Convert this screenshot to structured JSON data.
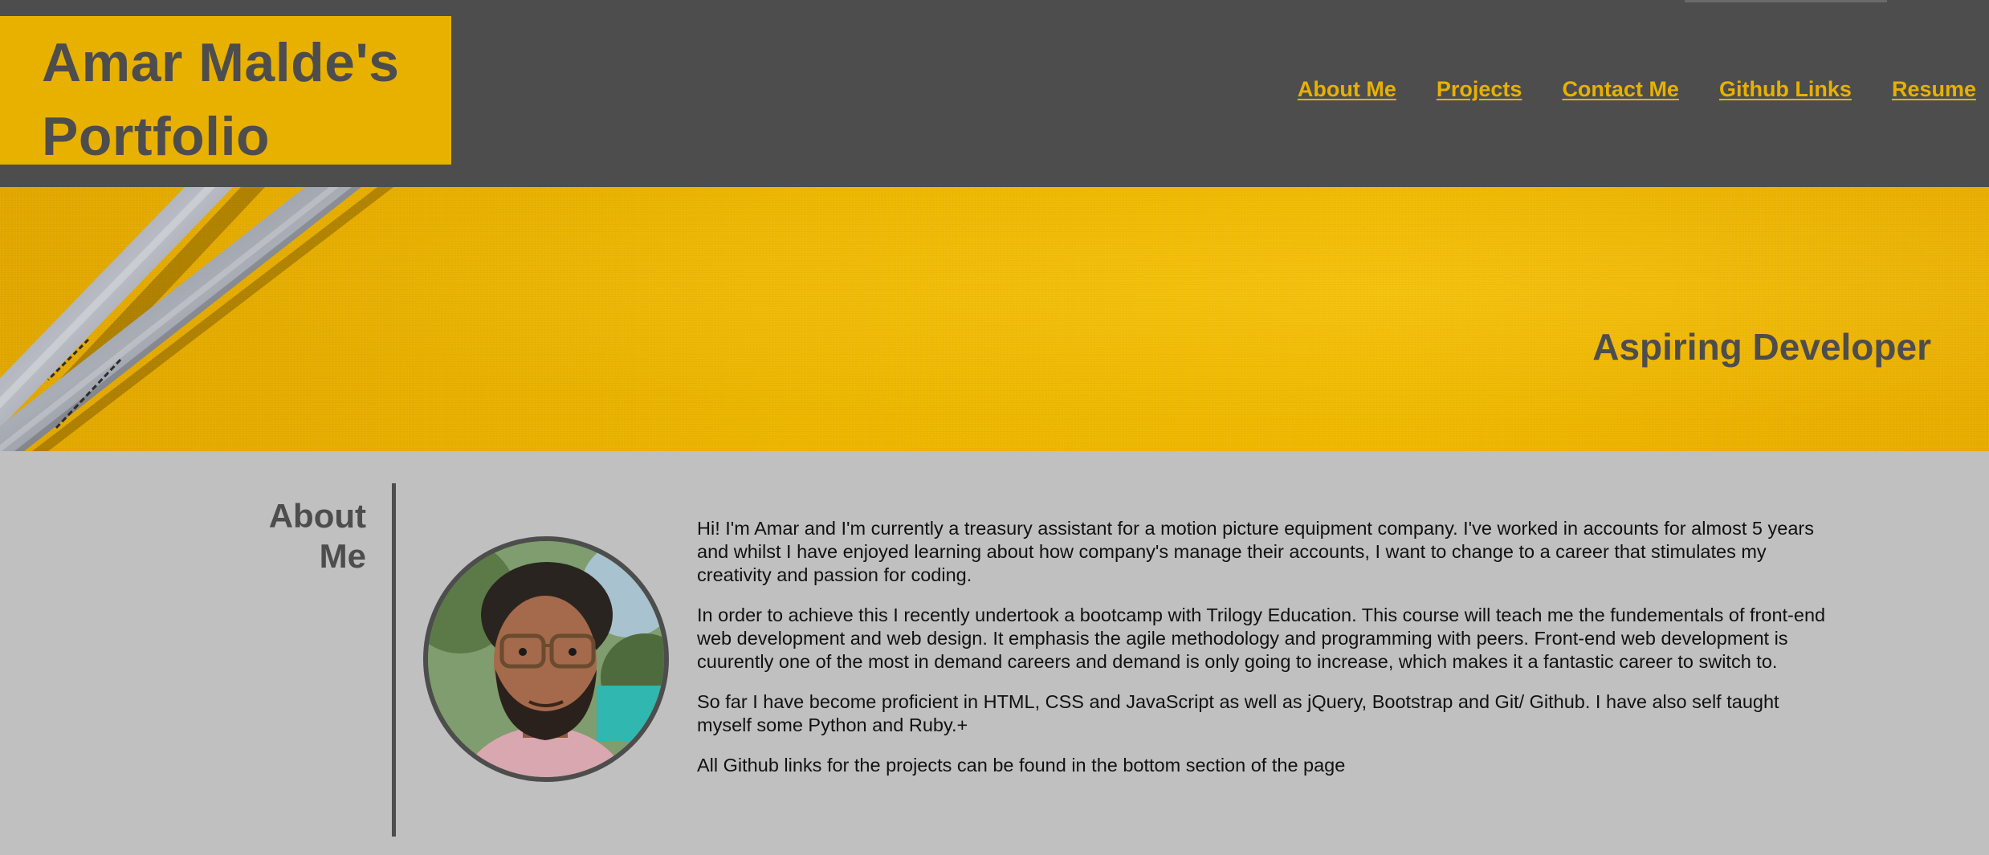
{
  "header": {
    "title": "Amar Malde's Portfolio",
    "nav": [
      {
        "label": "About Me"
      },
      {
        "label": "Projects"
      },
      {
        "label": "Contact Me"
      },
      {
        "label": "Github Links"
      },
      {
        "label": "Resume"
      }
    ]
  },
  "hero": {
    "tagline": "Aspiring Developer"
  },
  "about": {
    "heading": "About Me",
    "paragraphs": [
      "Hi! I'm Amar and I'm currently a treasury assistant for a motion picture equipment company. I've worked in accounts for almost 5 years and whilst I have enjoyed learning about how company's manage their accounts, I want to change to a career that stimulates my creativity and passion for coding.",
      "In order to achieve this I recently undertook a bootcamp with Trilogy Education. This course will teach me the fundementals of front-end web development and web design. It emphasis the agile methodology and programming with peers. Front-end web development is cuurently one of the most in demand careers and demand is only going to increase, which makes it a fantastic career to switch to.",
      "So far I have become proficient in HTML, CSS and JavaScript as well as jQuery, Bootstrap and Git/ Github. I have also self taught myself some Python and Ruby.+",
      "All Github links for the projects can be found in the bottom section of the page"
    ]
  },
  "colors": {
    "header_bg": "#4d4d4d",
    "accent": "#e8b100",
    "page_bg": "#c0c0c0",
    "heading_text": "#4d4d4d"
  }
}
